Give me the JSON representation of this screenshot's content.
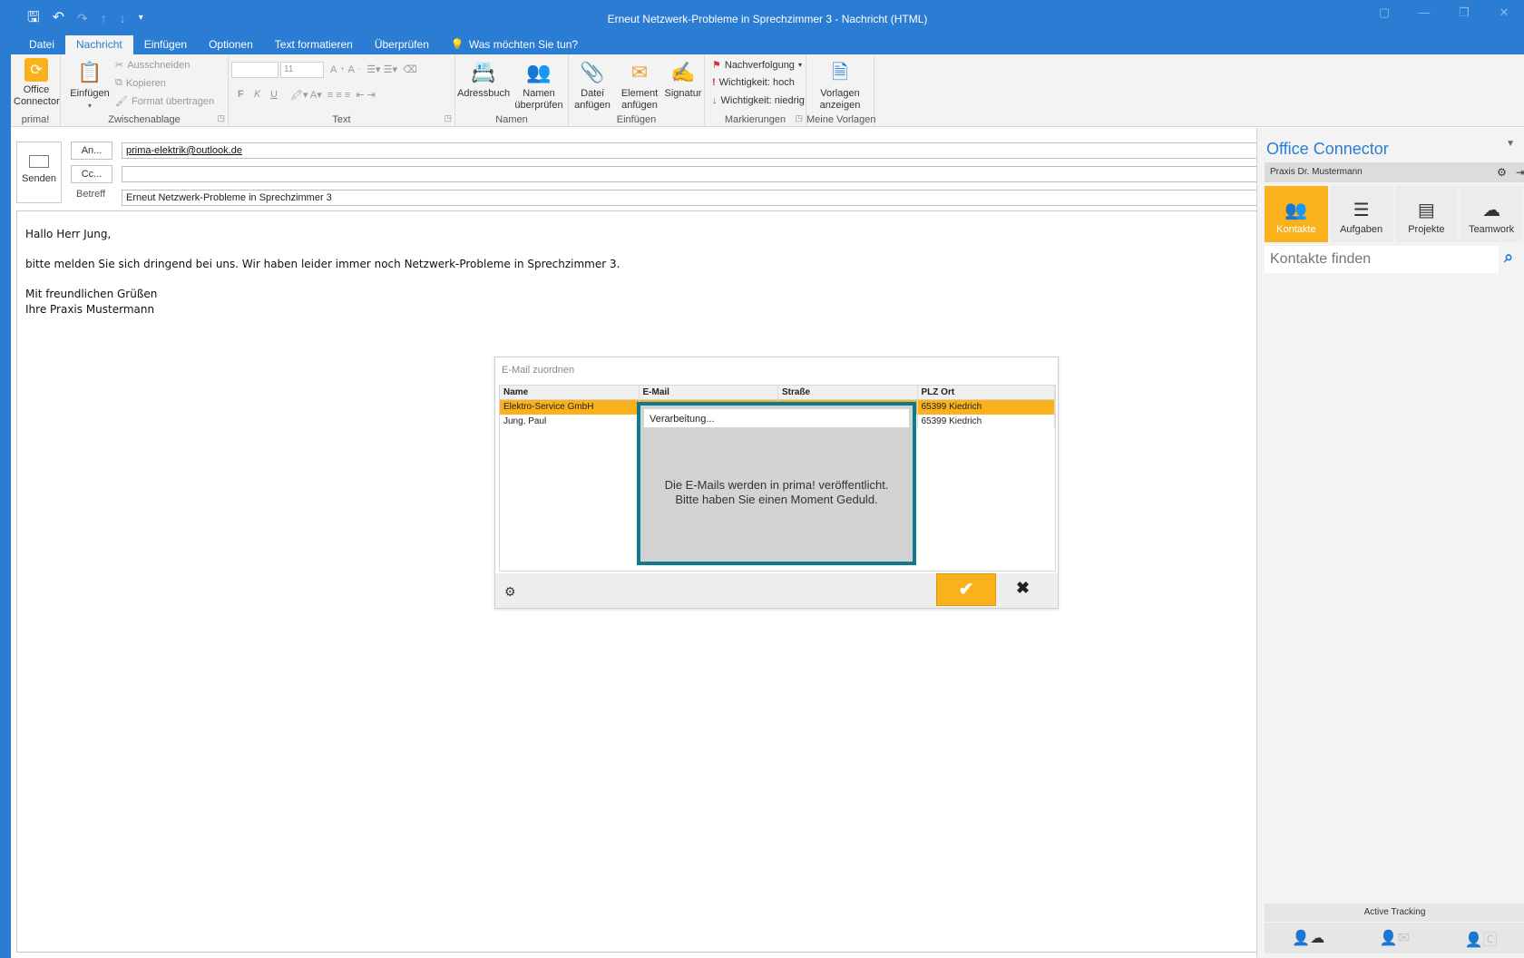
{
  "window": {
    "title": "Erneut Netzwerk-Probleme in Sprechzimmer 3 - Nachricht (HTML)"
  },
  "menu_tabs": [
    {
      "label": "Datei"
    },
    {
      "label": "Nachricht",
      "active": true
    },
    {
      "label": "Einfügen"
    },
    {
      "label": "Optionen"
    },
    {
      "label": "Text formatieren"
    },
    {
      "label": "Überprüfen"
    },
    {
      "label": "Was möchten Sie tun?"
    }
  ],
  "ribbon": {
    "prima_group": {
      "button": "Office Connector",
      "label": "prima!"
    },
    "clipboard": {
      "paste": "Einfügen",
      "cut": "Ausschneiden",
      "copy": "Kopieren",
      "format": "Format übertragen",
      "label": "Zwischenablage"
    },
    "text": {
      "font_size": "11",
      "bold": "F",
      "italic": "K",
      "underline": "U",
      "label": "Text"
    },
    "names": {
      "addressbook": "Adressbuch",
      "check_names": "Namen überprüfen",
      "label": "Namen"
    },
    "insert": {
      "attach_file": "Datei anfügen",
      "attach_item": "Element anfügen",
      "signature": "Signatur",
      "label": "Einfügen"
    },
    "tags": {
      "followup": "Nachverfolgung",
      "high": "Wichtigkeit: hoch",
      "low": "Wichtigkeit: niedrig",
      "label": "Markierungen"
    },
    "templates": {
      "show": "Vorlagen anzeigen",
      "label": "Meine Vorlagen"
    }
  },
  "compose": {
    "send": "Senden",
    "to_button": "An...",
    "to_value": "prima-elektrik@outlook.de",
    "cc_button": "Cc...",
    "cc_value": "",
    "subject_label": "Betreff",
    "subject_value": "Erneut Netzwerk-Probleme in Sprechzimmer 3",
    "body": [
      "Hallo Herr Jung,",
      "bitte melden Sie sich dringend bei uns. Wir haben leider immer noch Netzwerk-Probleme in Sprechzimmer 3.",
      "Mit freundlichen Grüßen",
      "Ihre Praxis Mustermann"
    ]
  },
  "dialog": {
    "title": "E-Mail zuordnen",
    "columns": [
      "Name",
      "E-Mail",
      "Straße",
      "PLZ Ort"
    ],
    "rows": [
      {
        "name": "Elektro-Service GmbH",
        "email": "",
        "street": "",
        "city": "65399 Kiedrich",
        "selected": true
      },
      {
        "name": "Jung, Paul",
        "email": "",
        "street": "",
        "city": "65399 Kiedrich",
        "selected": false
      }
    ],
    "progress": {
      "title": "Verarbeitung...",
      "line1": "Die E-Mails werden in prima! veröffentlicht.",
      "line2": "Bitte haben Sie einen Moment Geduld."
    }
  },
  "panel": {
    "title": "Office Connector",
    "account": "Praxis Dr. Mustermann",
    "tabs": [
      {
        "label": "Kontakte",
        "icon": "users-icon",
        "active": true
      },
      {
        "label": "Aufgaben",
        "icon": "tasks-icon"
      },
      {
        "label": "Projekte",
        "icon": "projects-icon"
      },
      {
        "label": "Teamwork",
        "icon": "cloud-icon"
      }
    ],
    "search_placeholder": "Kontakte finden",
    "tracking": "Active Tracking"
  },
  "colors": {
    "accent": "#2b7cd3",
    "prima_orange": "#f9b21c",
    "progress_border": "#0f7a8c"
  }
}
